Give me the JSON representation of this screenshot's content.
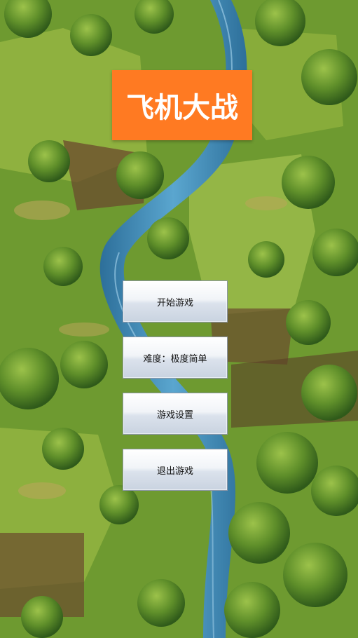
{
  "title": {
    "text": "飞机大战",
    "background": "#FF7A22",
    "color": "#FFFFFF"
  },
  "menu": {
    "start_label": "开始游戏",
    "difficulty_label": "难度：极度简单",
    "settings_label": "游戏设置",
    "exit_label": "退出游戏"
  },
  "background": {
    "description_icon": "forest-river-map",
    "grass_color": "#7FA63A",
    "river_color": "#3E86B8",
    "cliff_color": "#6B4A2E"
  }
}
